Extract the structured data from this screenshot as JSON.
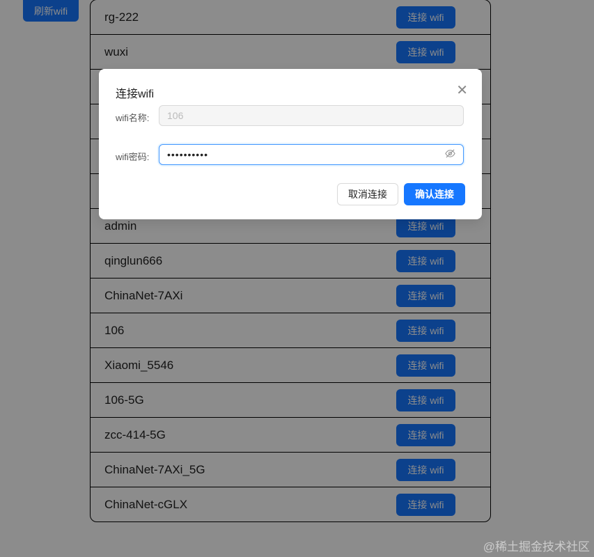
{
  "refresh_label": "刷新wifi",
  "connect_label": "连接 wifi",
  "networks": [
    "rg-222",
    "wuxi",
    "",
    "",
    "",
    "",
    "admin",
    "qinglun666",
    "ChinaNet-7AXi",
    "106",
    "Xiaomi_5546",
    "106-5G",
    "zcc-414-5G",
    "ChinaNet-7AXi_5G",
    "ChinaNet-cGLX"
  ],
  "modal": {
    "title": "连接wifi",
    "name_label": "wifi名称:",
    "name_value": "106",
    "password_label": "wifi密码:",
    "password_value": "••••••••••",
    "cancel_label": "取消连接",
    "confirm_label": "确认连接"
  },
  "watermark": "@稀土掘金技术社区",
  "colors": {
    "primary": "#1677ff"
  }
}
